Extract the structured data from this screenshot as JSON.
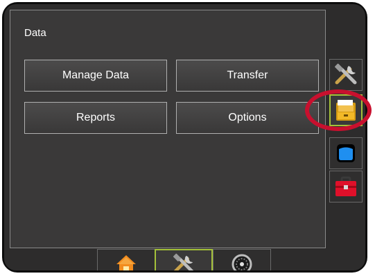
{
  "panel": {
    "title": "Data"
  },
  "buttons": {
    "manage_data": "Manage Data",
    "transfer": "Transfer",
    "reports": "Reports",
    "options": "Options"
  },
  "side_tabs": [
    {
      "icon": "tools-icon",
      "active": false
    },
    {
      "icon": "file-drawer-icon",
      "active": true,
      "highlighted": true
    },
    {
      "icon": "display-icon",
      "active": false
    },
    {
      "icon": "toolbox-icon",
      "active": false
    }
  ],
  "bottom_tabs": [
    {
      "icon": "home-icon",
      "active": false
    },
    {
      "icon": "tools-icon",
      "active": true
    },
    {
      "icon": "gauge-icon",
      "active": false
    }
  ],
  "colors": {
    "active_border": "#a5c239",
    "highlight_ring": "#c8102e",
    "panel_bg": "#3a3939"
  }
}
